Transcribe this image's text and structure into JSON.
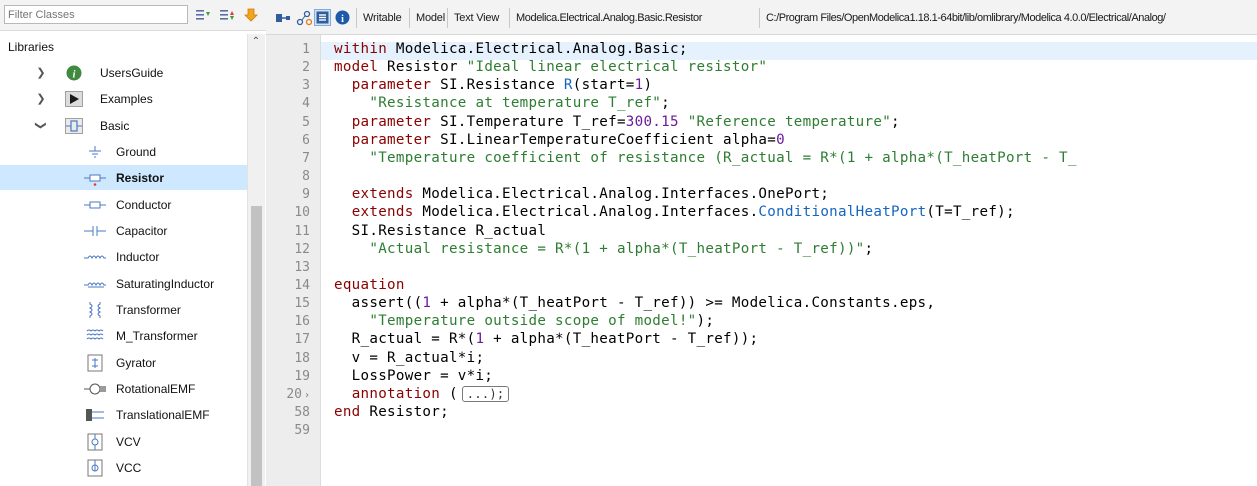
{
  "library_browser": {
    "filter_placeholder": "Filter Classes",
    "root_label": "Libraries",
    "items": [
      {
        "label": "UsersGuide",
        "icon": "info-circle-icon",
        "expander": "collapsed"
      },
      {
        "label": "Examples",
        "icon": "play-triangle-icon",
        "expander": "collapsed"
      },
      {
        "label": "Basic",
        "icon": "basic-package-icon",
        "expander": "expanded"
      },
      {
        "label": "Ground",
        "icon": "ground-symbol-icon"
      },
      {
        "label": "Resistor",
        "icon": "resistor-symbol-icon",
        "selected": true
      },
      {
        "label": "Conductor",
        "icon": "conductor-symbol-icon"
      },
      {
        "label": "Capacitor",
        "icon": "capacitor-symbol-icon"
      },
      {
        "label": "Inductor",
        "icon": "inductor-symbol-icon"
      },
      {
        "label": "SaturatingInductor",
        "icon": "saturating-inductor-symbol-icon"
      },
      {
        "label": "Transformer",
        "icon": "transformer-symbol-icon"
      },
      {
        "label": "M_Transformer",
        "icon": "m-transformer-symbol-icon"
      },
      {
        "label": "Gyrator",
        "icon": "gyrator-symbol-icon"
      },
      {
        "label": "RotationalEMF",
        "icon": "rotational-emf-symbol-icon"
      },
      {
        "label": "TranslationalEMF",
        "icon": "translational-emf-symbol-icon"
      },
      {
        "label": "VCV",
        "icon": "vcv-symbol-icon"
      },
      {
        "label": "VCC",
        "icon": "vcc-symbol-icon"
      }
    ]
  },
  "editor_toolbar": {
    "icons": [
      "diagram-view-icon",
      "icon-view-icon",
      "text-view-icon",
      "documentation-view-icon"
    ],
    "labels": {
      "access": "Writable",
      "restriction": "Model",
      "view": "Text View",
      "class_name": "Modelica.Electrical.Analog.Basic.Resistor",
      "file_path": "C:/Program Files/OpenModelica1.18.1-64bit/lib/omlibrary/Modelica 4.0.0/Electrical/Analog/"
    }
  },
  "editor": {
    "line_numbers": [
      "1",
      "2",
      "3",
      "4",
      "5",
      "6",
      "7",
      "8",
      "9",
      "10",
      "11",
      "12",
      "13",
      "14",
      "15",
      "16",
      "17",
      "18",
      "19",
      "20",
      "58",
      "59"
    ],
    "lines": [
      [
        {
          "t": "within",
          "c": "kw"
        },
        {
          "t": " Modelica.Electrical.Analog.Basic;"
        }
      ],
      [
        {
          "t": "model",
          "c": "kw"
        },
        {
          "t": " Resistor "
        },
        {
          "t": "\"Ideal linear electrical resistor\"",
          "c": "str"
        }
      ],
      [
        {
          "t": "  "
        },
        {
          "t": "parameter",
          "c": "kw"
        },
        {
          "t": " SI.Resistance "
        },
        {
          "t": "R",
          "c": "typ"
        },
        {
          "t": "(start="
        },
        {
          "t": "1",
          "c": "num"
        },
        {
          "t": ")"
        }
      ],
      [
        {
          "t": "    "
        },
        {
          "t": "\"Resistance at temperature T_ref\"",
          "c": "str"
        },
        {
          "t": ";"
        }
      ],
      [
        {
          "t": "  "
        },
        {
          "t": "parameter",
          "c": "kw"
        },
        {
          "t": " SI.Temperature T_ref="
        },
        {
          "t": "300.15",
          "c": "num"
        },
        {
          "t": " "
        },
        {
          "t": "\"Reference temperature\"",
          "c": "str"
        },
        {
          "t": ";"
        }
      ],
      [
        {
          "t": "  "
        },
        {
          "t": "parameter",
          "c": "kw"
        },
        {
          "t": " SI.LinearTemperatureCoefficient alpha="
        },
        {
          "t": "0",
          "c": "num"
        }
      ],
      [
        {
          "t": "    "
        },
        {
          "t": "\"Temperature coefficient of resistance (R_actual = R*(1 + alpha*(T_heatPort - T_",
          "c": "str"
        }
      ],
      [],
      [
        {
          "t": "  "
        },
        {
          "t": "extends",
          "c": "kw"
        },
        {
          "t": " Modelica.Electrical.Analog.Interfaces.OnePort;"
        }
      ],
      [
        {
          "t": "  "
        },
        {
          "t": "extends",
          "c": "kw"
        },
        {
          "t": " Modelica.Electrical.Analog.Interfaces."
        },
        {
          "t": "ConditionalHeatPort",
          "c": "typ"
        },
        {
          "t": "(T=T_ref);"
        }
      ],
      [
        {
          "t": "  SI.Resistance R_actual"
        }
      ],
      [
        {
          "t": "    "
        },
        {
          "t": "\"Actual resistance = R*(1 + alpha*(T_heatPort - T_ref))\"",
          "c": "str"
        },
        {
          "t": ";"
        }
      ],
      [],
      [
        {
          "t": "equation",
          "c": "kw"
        }
      ],
      [
        {
          "t": "  assert(("
        },
        {
          "t": "1",
          "c": "num"
        },
        {
          "t": " + alpha*(T_heatPort - T_ref)) >= Modelica.Constants.eps,"
        }
      ],
      [
        {
          "t": "    "
        },
        {
          "t": "\"Temperature outside scope of model!\"",
          "c": "str"
        },
        {
          "t": ");"
        }
      ],
      [
        {
          "t": "  R_actual = R*("
        },
        {
          "t": "1",
          "c": "num"
        },
        {
          "t": " + alpha*(T_heatPort - T_ref));"
        }
      ],
      [
        {
          "t": "  v = R_actual*i;"
        }
      ],
      [
        {
          "t": "  LossPower = v*i;"
        }
      ],
      [
        {
          "t": "  "
        },
        {
          "t": "annotation",
          "c": "kw"
        },
        {
          "t": " ("
        },
        {
          "t": "...);",
          "c": "collapsed"
        }
      ],
      [
        {
          "t": "end",
          "c": "kw"
        },
        {
          "t": " Resistor;"
        }
      ],
      []
    ],
    "folded_line_marker": "›"
  },
  "colors": {
    "keyword": "#8b0000",
    "string": "#2e7d32",
    "number": "#6a1b9a",
    "identifier_link": "#1565c0",
    "selection": "#cde8ff",
    "current_line": "#e5f1fc"
  }
}
